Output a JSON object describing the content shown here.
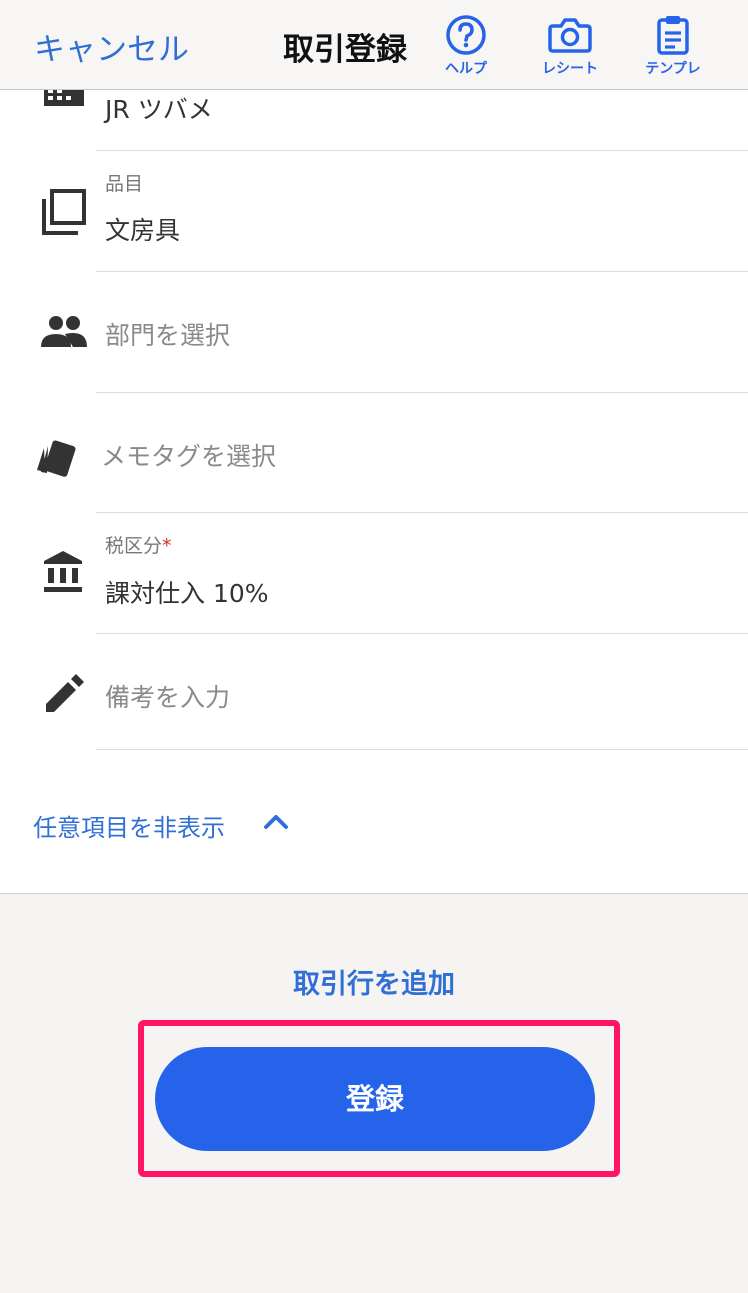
{
  "header": {
    "cancel_label": "キャンセル",
    "title": "取引登録",
    "actions": [
      {
        "label": "ヘルプ",
        "icon": "help-circle-icon"
      },
      {
        "label": "レシート",
        "icon": "camera-icon"
      },
      {
        "label": "テンプレ",
        "icon": "clipboard-icon"
      }
    ]
  },
  "form": {
    "partner": {
      "value": "JR ツバメ",
      "icon": "building-icon"
    },
    "item": {
      "label": "品目",
      "value": "文房具",
      "icon": "copy-icon"
    },
    "department": {
      "placeholder": "部門を選択",
      "icon": "people-icon"
    },
    "memo_tag": {
      "placeholder": "メモタグを選択",
      "icon": "tag-icon"
    },
    "tax": {
      "label": "税区分",
      "required_mark": "*",
      "value": "課対仕入 10%",
      "icon": "bank-icon"
    },
    "note": {
      "placeholder": "備考を入力",
      "icon": "pencil-icon"
    },
    "toggle_optional_label": "任意項目を非表示"
  },
  "footer": {
    "add_line_label": "取引行を追加",
    "submit_label": "登録"
  },
  "colors": {
    "accent": "#2563eb",
    "highlight": "#ff1563"
  }
}
